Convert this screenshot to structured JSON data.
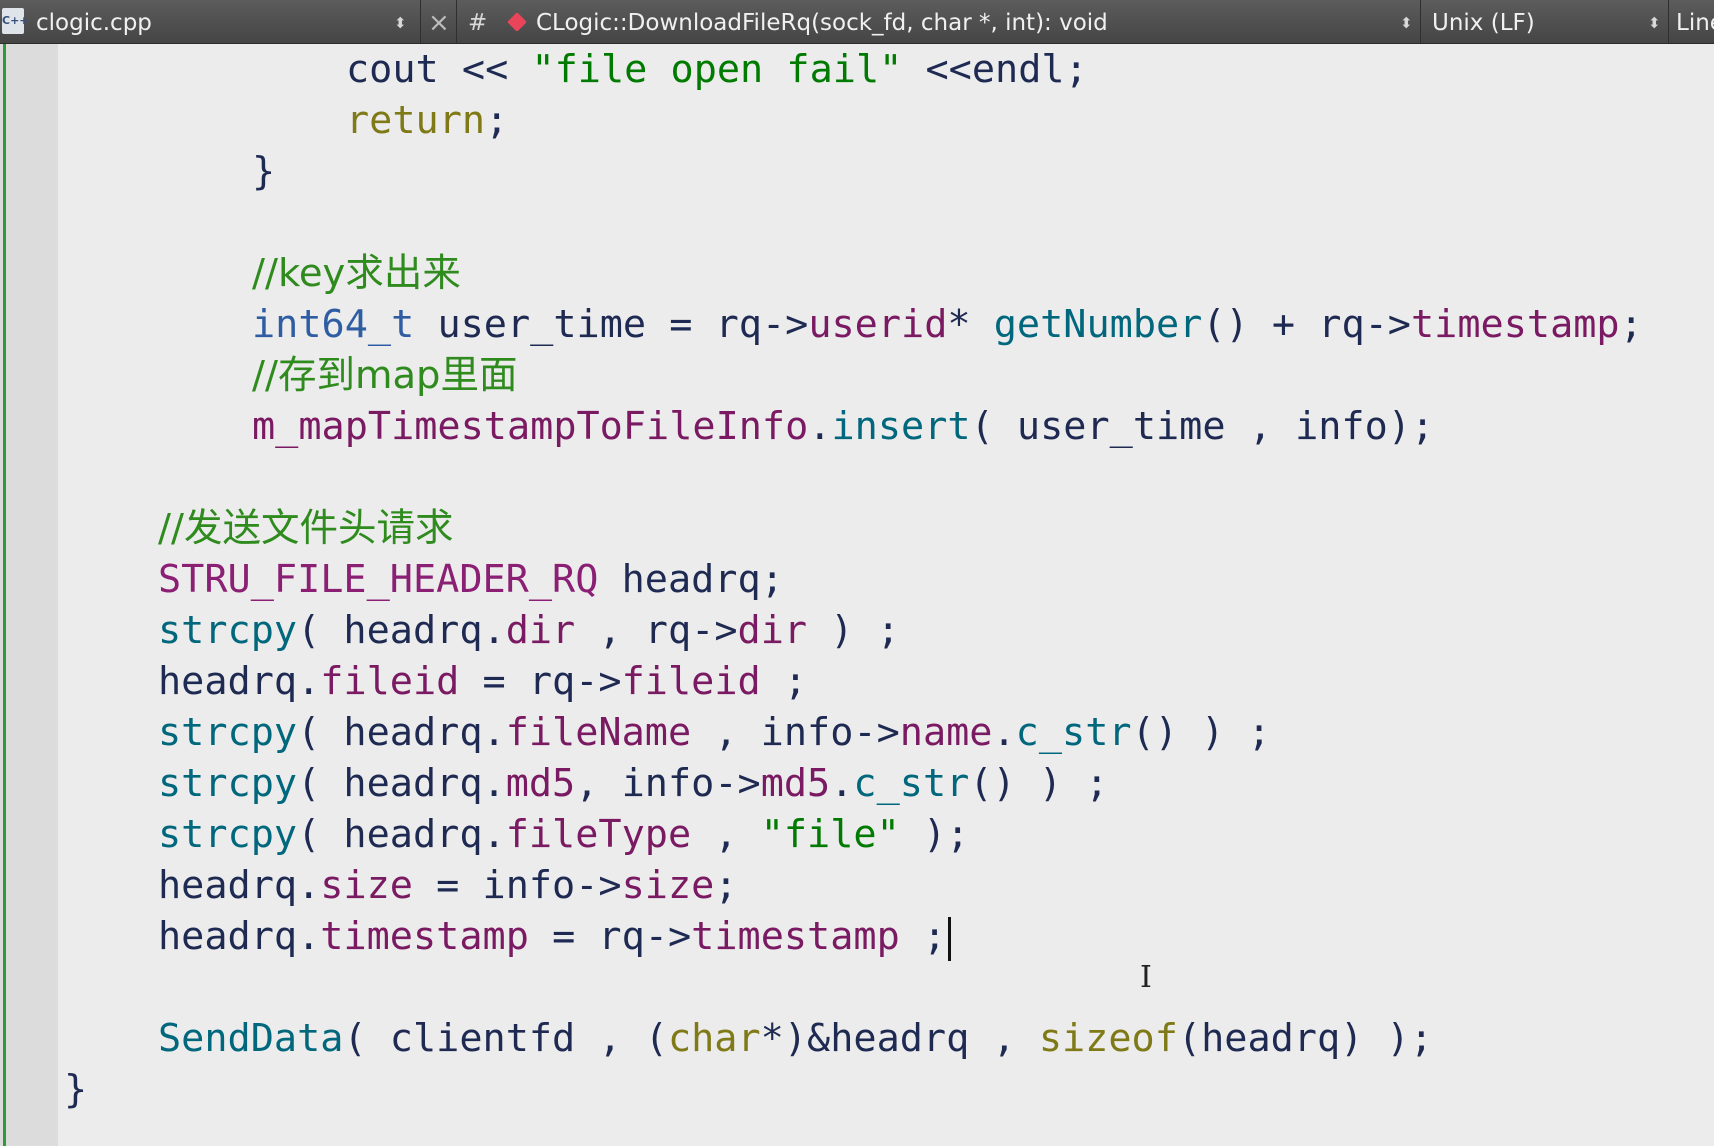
{
  "toolbar": {
    "file_icon_text": "C++",
    "file_name": "clogic.cpp",
    "file_switch_icon": "updown-arrows-icon",
    "close_glyph": "×",
    "hash_glyph": "#",
    "symbol_icon": "function-marker-icon",
    "function_signature": "CLogic::DownloadFileRq(sock_fd, char *, int): void",
    "line_endings": "Unix (LF)",
    "position_label": "Line"
  },
  "colors": {
    "comment": "#2f8b1e",
    "string": "#007a00",
    "keyword": "#7f7a17",
    "type": "#2f5da3",
    "function": "#00677c",
    "member": "#7a1a62",
    "plain": "#1e2a52",
    "change_bar": "#2e9b3a"
  },
  "code": {
    "lines": [
      {
        "indent": 3,
        "tokens": [
          [
            "cout << ",
            "plain"
          ],
          [
            "\"file open fail\"",
            "string"
          ],
          [
            " <<endl;",
            "plain"
          ]
        ]
      },
      {
        "indent": 3,
        "tokens": [
          [
            "return",
            "keyword"
          ],
          [
            ";",
            "plain"
          ]
        ]
      },
      {
        "indent": 2,
        "tokens": [
          [
            "}",
            "plain"
          ]
        ]
      },
      {
        "indent": 0,
        "tokens": []
      },
      {
        "indent": 2,
        "tokens": [
          [
            "//key求出来",
            "comment"
          ]
        ]
      },
      {
        "indent": 2,
        "tokens": [
          [
            "int64_t",
            "type"
          ],
          [
            " user_time = rq->",
            "plain"
          ],
          [
            "userid",
            "member"
          ],
          [
            "* ",
            "plain"
          ],
          [
            "getNumber",
            "func"
          ],
          [
            "() + rq->",
            "plain"
          ],
          [
            "timestamp",
            "member"
          ],
          [
            ";",
            "plain"
          ]
        ]
      },
      {
        "indent": 2,
        "tokens": [
          [
            "//存到map里面",
            "comment"
          ]
        ]
      },
      {
        "indent": 2,
        "tokens": [
          [
            "m_mapTimestampToFileInfo",
            "member"
          ],
          [
            ".",
            "plain"
          ],
          [
            "insert",
            "func"
          ],
          [
            "( user_time , info);",
            "plain"
          ]
        ]
      },
      {
        "indent": 0,
        "tokens": []
      },
      {
        "indent": 1,
        "tokens": [
          [
            "//发送文件头请求",
            "comment"
          ]
        ]
      },
      {
        "indent": 1,
        "tokens": [
          [
            "STRU_FILE_HEADER_RQ",
            "macro"
          ],
          [
            " headrq;",
            "plain"
          ]
        ]
      },
      {
        "indent": 1,
        "tokens": [
          [
            "strcpy",
            "func"
          ],
          [
            "( headrq.",
            "plain"
          ],
          [
            "dir",
            "member"
          ],
          [
            " , rq->",
            "plain"
          ],
          [
            "dir",
            "member"
          ],
          [
            " ) ;",
            "plain"
          ]
        ]
      },
      {
        "indent": 1,
        "tokens": [
          [
            "headrq.",
            "plain"
          ],
          [
            "fileid",
            "member"
          ],
          [
            " = rq->",
            "plain"
          ],
          [
            "fileid",
            "member"
          ],
          [
            " ;",
            "plain"
          ]
        ]
      },
      {
        "indent": 1,
        "tokens": [
          [
            "strcpy",
            "func"
          ],
          [
            "( headrq.",
            "plain"
          ],
          [
            "fileName",
            "member"
          ],
          [
            " , info->",
            "plain"
          ],
          [
            "name",
            "member"
          ],
          [
            ".",
            "plain"
          ],
          [
            "c_str",
            "func"
          ],
          [
            "() ) ;",
            "plain"
          ]
        ]
      },
      {
        "indent": 1,
        "tokens": [
          [
            "strcpy",
            "func"
          ],
          [
            "( headrq.",
            "plain"
          ],
          [
            "md5",
            "member"
          ],
          [
            ", info->",
            "plain"
          ],
          [
            "md5",
            "member"
          ],
          [
            ".",
            "plain"
          ],
          [
            "c_str",
            "func"
          ],
          [
            "() ) ;",
            "plain"
          ]
        ]
      },
      {
        "indent": 1,
        "tokens": [
          [
            "strcpy",
            "func"
          ],
          [
            "( headrq.",
            "plain"
          ],
          [
            "fileType",
            "member"
          ],
          [
            " , ",
            "plain"
          ],
          [
            "\"file\"",
            "string"
          ],
          [
            " );",
            "plain"
          ]
        ]
      },
      {
        "indent": 1,
        "tokens": [
          [
            "headrq.",
            "plain"
          ],
          [
            "size",
            "member"
          ],
          [
            " = info->",
            "plain"
          ],
          [
            "size",
            "member"
          ],
          [
            ";",
            "plain"
          ]
        ]
      },
      {
        "indent": 1,
        "tokens": [
          [
            "headrq.",
            "plain"
          ],
          [
            "timestamp",
            "member"
          ],
          [
            " = rq->",
            "plain"
          ],
          [
            "timestamp",
            "member"
          ],
          [
            " ;",
            "plain"
          ]
        ],
        "caret": true
      },
      {
        "indent": 0,
        "tokens": []
      },
      {
        "indent": 1,
        "tokens": [
          [
            "SendData",
            "func"
          ],
          [
            "( clientfd , (",
            "plain"
          ],
          [
            "char",
            "keyword"
          ],
          [
            "*)&headrq , ",
            "plain"
          ],
          [
            "sizeof",
            "keyword"
          ],
          [
            "(headrq) );",
            "plain"
          ]
        ]
      },
      {
        "indent": 0,
        "tokens": [
          [
            "}",
            "plain"
          ]
        ]
      }
    ]
  }
}
